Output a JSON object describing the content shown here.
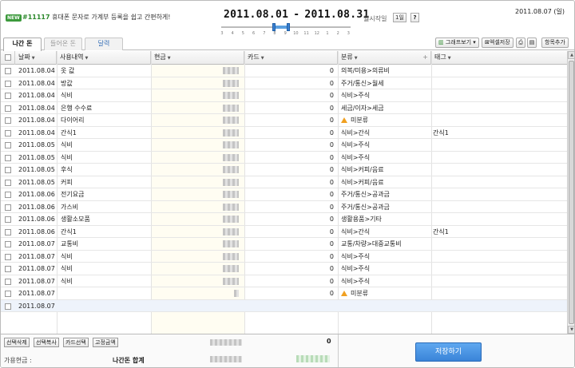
{
  "header": {
    "new_badge": "NEW",
    "notice_number": "#11117",
    "notice_text": "휴대폰 문자로 가계부 등록을 쉽고 간편하게!",
    "period_start": "2011.08.01",
    "period_sep": "-",
    "period_end": "2011.08.31",
    "start_day_label": "월시작일",
    "start_day_button": "1일",
    "help_button": "?",
    "today": "2011.08.07 (일)",
    "slider_ticks": [
      "3",
      "4",
      "5",
      "6",
      "7",
      "8",
      "9",
      "10",
      "11",
      "12",
      "1",
      "2",
      "3"
    ]
  },
  "tabs": [
    {
      "label": "나간 돈",
      "active": true
    },
    {
      "label": "들어온 돈",
      "active": false
    },
    {
      "label": "달력",
      "active": false
    }
  ],
  "toolbar": {
    "graph": "그래프보기",
    "excel": "엑셀저장",
    "add_item": "항목추가"
  },
  "columns": {
    "date": "날짜",
    "desc": "사용내역",
    "cash": "현금",
    "card": "카드",
    "category": "분류",
    "tag": "태그"
  },
  "rows": [
    {
      "date": "2011.08.04",
      "desc": "옷 값",
      "card": "0",
      "category": "의복/미용>의류비",
      "tag": "",
      "warn": false
    },
    {
      "date": "2011.08.04",
      "desc": "방값",
      "card": "0",
      "category": "주거/통신>월세",
      "tag": "",
      "warn": false
    },
    {
      "date": "2011.08.04",
      "desc": "식비",
      "card": "0",
      "category": "식비>주식",
      "tag": "",
      "warn": false
    },
    {
      "date": "2011.08.04",
      "desc": "은행 수수료",
      "card": "0",
      "category": "세금/이자>세금",
      "tag": "",
      "warn": false
    },
    {
      "date": "2011.08.04",
      "desc": "다이어리",
      "card": "0",
      "category": "미분류",
      "tag": "",
      "warn": true
    },
    {
      "date": "2011.08.04",
      "desc": "간식1",
      "card": "0",
      "category": "식비>간식",
      "tag": "간식1",
      "warn": false
    },
    {
      "date": "2011.08.05",
      "desc": "식비",
      "card": "0",
      "category": "식비>주식",
      "tag": "",
      "warn": false
    },
    {
      "date": "2011.08.05",
      "desc": "식비",
      "card": "0",
      "category": "식비>주식",
      "tag": "",
      "warn": false
    },
    {
      "date": "2011.08.05",
      "desc": "후식",
      "card": "0",
      "category": "식비>커피/음료",
      "tag": "",
      "warn": false
    },
    {
      "date": "2011.08.05",
      "desc": "커피",
      "card": "0",
      "category": "식비>커피/음료",
      "tag": "",
      "warn": false
    },
    {
      "date": "2011.08.06",
      "desc": "전기요금",
      "card": "0",
      "category": "주거/통신>공과금",
      "tag": "",
      "warn": false
    },
    {
      "date": "2011.08.06",
      "desc": "가스비",
      "card": "0",
      "category": "주거/통신>공과금",
      "tag": "",
      "warn": false
    },
    {
      "date": "2011.08.06",
      "desc": "생활소모품",
      "card": "0",
      "category": "생활용품>기타",
      "tag": "",
      "warn": false
    },
    {
      "date": "2011.08.06",
      "desc": "간식1",
      "card": "0",
      "category": "식비>간식",
      "tag": "간식1",
      "warn": false
    },
    {
      "date": "2011.08.07",
      "desc": "교통비",
      "card": "0",
      "category": "교통/차량>대중교통비",
      "tag": "",
      "warn": false
    },
    {
      "date": "2011.08.07",
      "desc": "식비",
      "card": "0",
      "category": "식비>주식",
      "tag": "",
      "warn": false
    },
    {
      "date": "2011.08.07",
      "desc": "식비",
      "card": "0",
      "category": "식비>주식",
      "tag": "",
      "warn": false
    },
    {
      "date": "2011.08.07",
      "desc": "식비",
      "card": "0",
      "category": "식비>주식",
      "tag": "",
      "warn": false
    },
    {
      "date": "2011.08.07",
      "desc": "",
      "card": "0",
      "category": "미분류",
      "tag": "",
      "warn": true
    },
    {
      "date": "2011.08.07",
      "desc": "",
      "card": "",
      "category": "",
      "tag": "",
      "warn": false
    }
  ],
  "footer": {
    "delete_selected": "선택삭제",
    "copy_selected": "선택복사",
    "card_select": "카드선택",
    "fixed_amount": "고정금액",
    "card_total": "0",
    "available_cash_label": "가용현금 :",
    "remaining_label": "나간돈 합계",
    "save_button": "저장하기"
  },
  "colors": {
    "accent_blue": "#3a84d8",
    "notice_green": "#2e8a2e",
    "warning_orange": "#f0a020",
    "cash_column_bg": "#fffdf2"
  }
}
